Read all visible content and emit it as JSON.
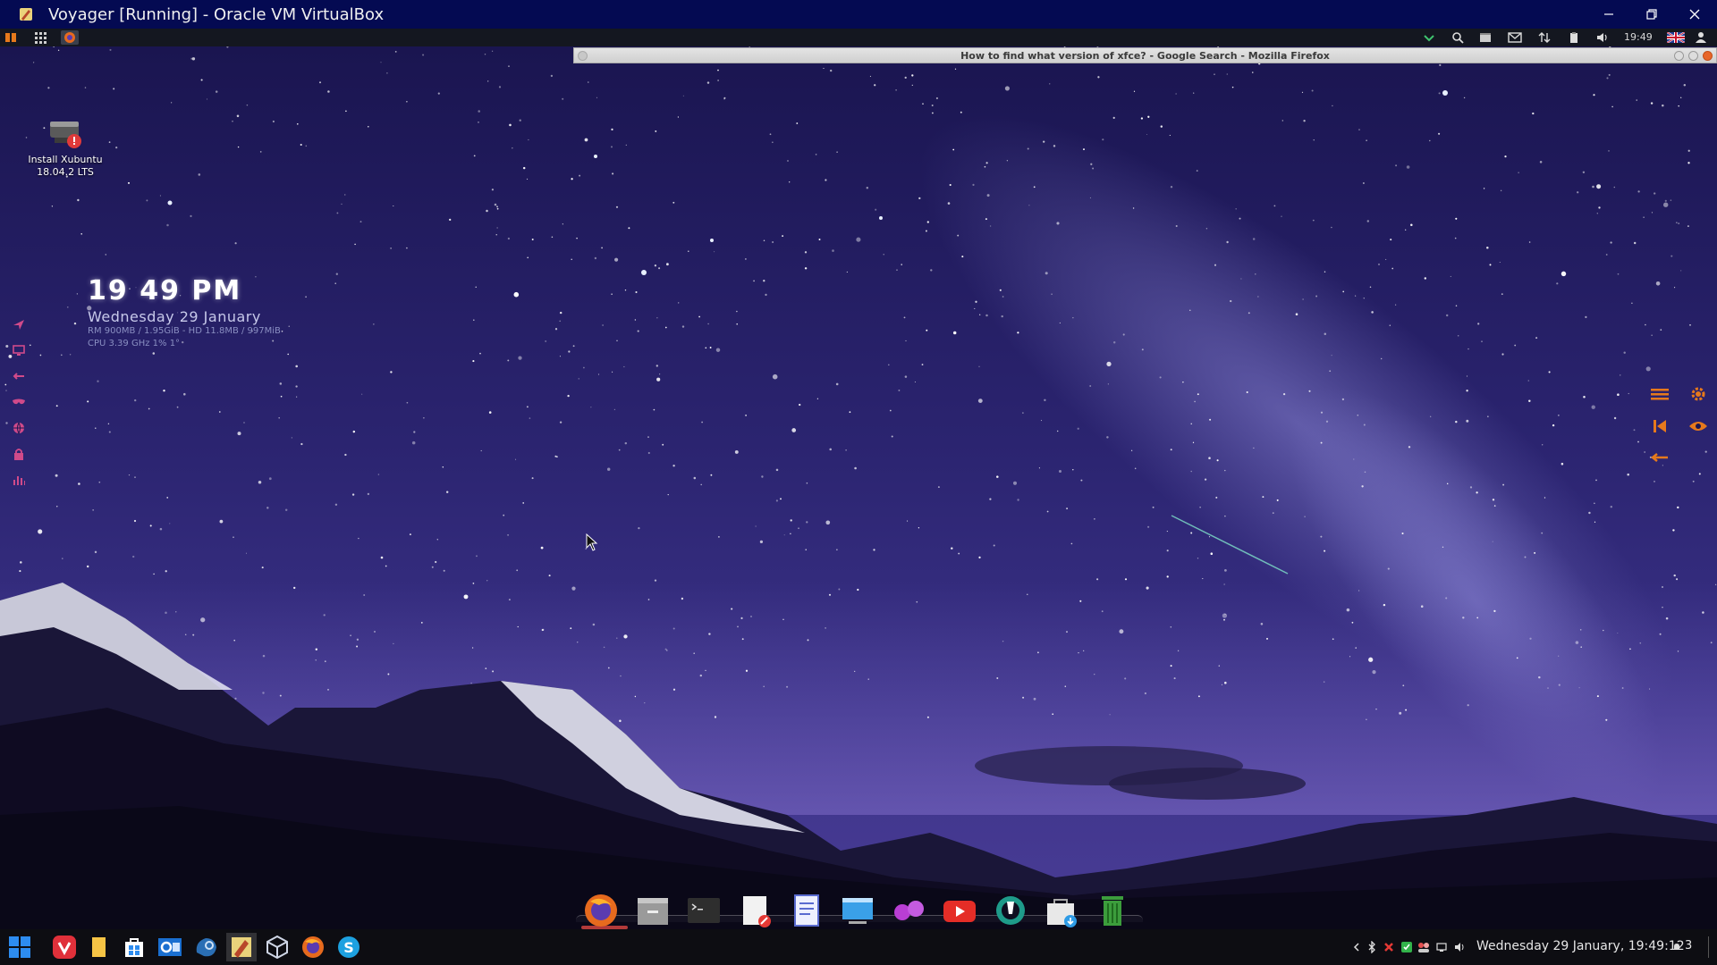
{
  "window": {
    "title": "Voyager [Running] - Oracle VM VirtualBox",
    "controls": [
      "minimize",
      "restore",
      "close"
    ]
  },
  "top_panel": {
    "clock": "19:49",
    "left_icons": [
      "whisker-menu-icon",
      "app-grid-icon",
      "firefox-icon"
    ],
    "right_icons": [
      "network-check-icon",
      "search-icon",
      "window-list-icon",
      "mail-icon",
      "transfer-icon",
      "clipboard-icon",
      "volume-icon",
      "uk-flag-icon",
      "user-icon"
    ]
  },
  "firefox_window": {
    "title": "How to find what version of xfce? - Google Search - Mozilla Firefox"
  },
  "desktop_icon": {
    "label_line1": "Install Xubuntu",
    "label_line2": "18.04.2 LTS"
  },
  "conky": {
    "time": "19 49 PM",
    "date": "Wednesday 29 January",
    "mem_line": "RM 900MB / 1.95GiB - HD 11.8MB / 997MiB",
    "cpu_line": "CPU 3.39 GHz 1% 1°"
  },
  "dock": {
    "items": [
      "firefox",
      "file-manager",
      "terminal",
      "text-editor",
      "document-viewer",
      "display",
      "dual-apps",
      "youtube",
      "settings-manager",
      "software-center",
      "trash"
    ]
  },
  "taskbar": {
    "datetime": "Wednesday 29 January, 19:49:12",
    "notification_count": "3",
    "items": [
      "windows-start",
      "vivaldi",
      "files",
      "store",
      "outlook",
      "steam",
      "virtualbox-task",
      "3d-viewer",
      "firefox-task",
      "skype"
    ]
  },
  "colors": {
    "titlebar": "#040a52",
    "panel": "#141720",
    "taskbar": "#0d0d12",
    "accent_orange": "#e6791c",
    "sky_top": "#1a1550",
    "sky_mid": "#3b3288"
  }
}
